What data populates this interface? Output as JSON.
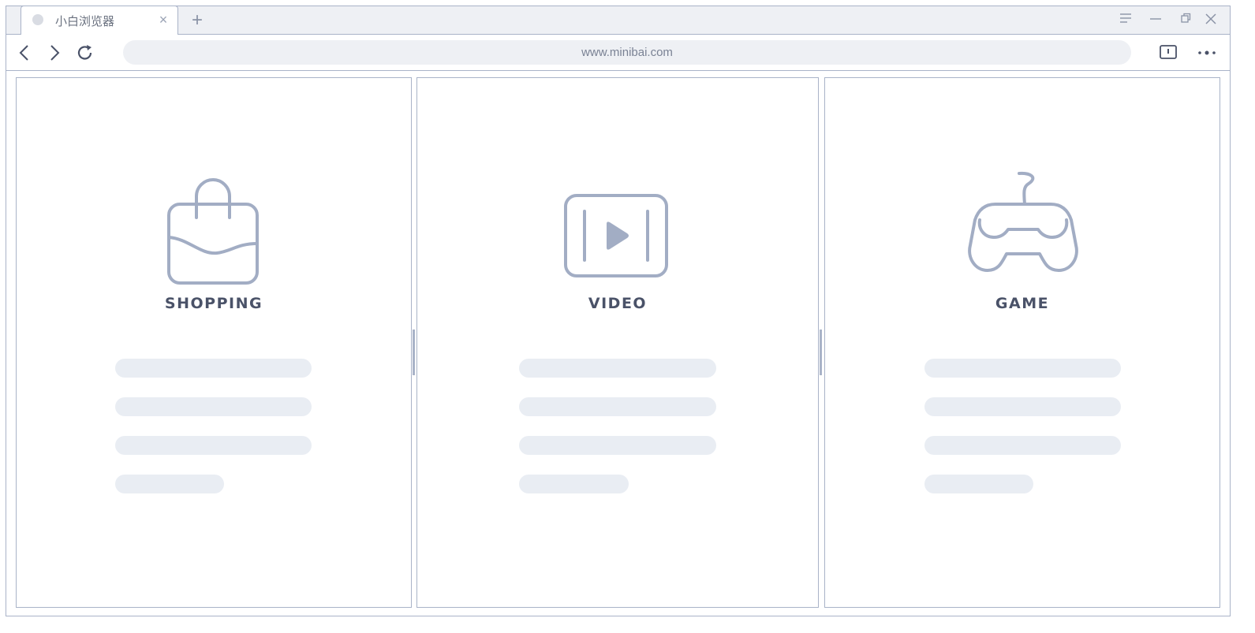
{
  "tab": {
    "title": "小白浏览器",
    "close_glyph": "×",
    "new_tab_glyph": "+"
  },
  "window_controls": {
    "menu_icon": "menu-icon",
    "minimize_icon": "minimize-icon",
    "restore_icon": "restore-icon",
    "close_icon": "close-icon"
  },
  "toolbar": {
    "address": "www.minibai.com",
    "back_icon": "back-arrow-icon",
    "forward_icon": "forward-arrow-icon",
    "reload_icon": "reload-icon",
    "alert_icon": "alert-box-icon",
    "more_icon": "more-dots-icon"
  },
  "panels": [
    {
      "label": "SHOPPING",
      "icon": "shopping-bag-icon"
    },
    {
      "label": "VIDEO",
      "icon": "video-play-icon"
    },
    {
      "label": "GAME",
      "icon": "gamepad-icon"
    }
  ],
  "colors": {
    "border": "#a9b3c8",
    "icon_stroke": "#a2adc4",
    "skeleton": "#e9edf3",
    "label": "#4a5268",
    "tabbar_bg": "#eef0f4"
  }
}
